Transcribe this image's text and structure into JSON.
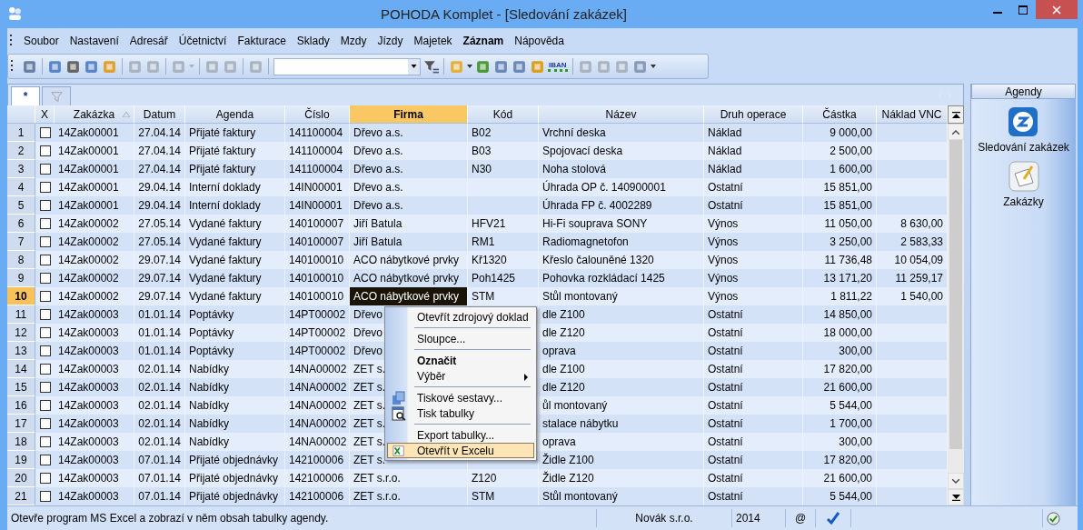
{
  "window": {
    "title": "POHODA Komplet - [Sledování zakázek]"
  },
  "menu": [
    {
      "label": "Soubor",
      "bold": false
    },
    {
      "label": "Nastavení",
      "bold": false
    },
    {
      "label": "Adresář",
      "bold": false
    },
    {
      "label": "Účetnictví",
      "bold": false
    },
    {
      "label": "Fakturace",
      "bold": false
    },
    {
      "label": "Sklady",
      "bold": false
    },
    {
      "label": "Mzdy",
      "bold": false
    },
    {
      "label": "Jízdy",
      "bold": false
    },
    {
      "label": "Majetek",
      "bold": false
    },
    {
      "label": "Záznam",
      "bold": true
    },
    {
      "label": "Nápověda",
      "bold": false
    }
  ],
  "toolbar": {
    "badge": "IBAN"
  },
  "tabs": [
    {
      "kind": "text",
      "label": "*",
      "selected": true
    },
    {
      "kind": "filter",
      "selected": false
    }
  ],
  "columns": [
    {
      "label": "X",
      "selected": false,
      "sorted": false
    },
    {
      "label": "Zakázka",
      "selected": false,
      "sorted": true
    },
    {
      "label": "Datum",
      "selected": false,
      "sorted": false
    },
    {
      "label": "Agenda",
      "selected": false,
      "sorted": false
    },
    {
      "label": "Číslo",
      "selected": false,
      "sorted": false
    },
    {
      "label": "Firma",
      "selected": true,
      "sorted": false
    },
    {
      "label": "Kód",
      "selected": false,
      "sorted": false
    },
    {
      "label": "Název",
      "selected": false,
      "sorted": false
    },
    {
      "label": "Druh operace",
      "selected": false,
      "sorted": false
    },
    {
      "label": "Částka",
      "selected": false,
      "sorted": false
    },
    {
      "label": "Náklad VNC",
      "selected": false,
      "sorted": false
    }
  ],
  "rows": [
    {
      "n": "1",
      "checked": false,
      "selected": false,
      "zakazka": "14Zak00001",
      "datum": "27.04.14",
      "agenda": "Přijaté faktury",
      "cislo": "141100004",
      "firma": "Dřevo a.s.",
      "kod": "B02",
      "nazev": "Vrchní deska",
      "druh": "Náklad",
      "castka": "9 000,00"
    },
    {
      "n": "2",
      "checked": false,
      "selected": false,
      "zakazka": "14Zak00001",
      "datum": "27.04.14",
      "agenda": "Přijaté faktury",
      "cislo": "141100004",
      "firma": "Dřevo a.s.",
      "kod": "B03",
      "nazev": "Spojovací deska",
      "druh": "Náklad",
      "castka": "2 500,00"
    },
    {
      "n": "3",
      "checked": false,
      "selected": false,
      "zakazka": "14Zak00001",
      "datum": "27.04.14",
      "agenda": "Přijaté faktury",
      "cislo": "141100004",
      "firma": "Dřevo a.s.",
      "kod": "N30",
      "nazev": "Noha stolová",
      "druh": "Náklad",
      "castka": "1 600,00"
    },
    {
      "n": "4",
      "checked": false,
      "selected": false,
      "zakazka": "14Zak00001",
      "datum": "29.04.14",
      "agenda": "Interní doklady",
      "cislo": "14IN00001",
      "firma": "Dřevo a.s.",
      "nazev": "Úhrada OP č. 140900001",
      "druh": "Ostatní",
      "castka": "15 851,00"
    },
    {
      "n": "5",
      "checked": false,
      "selected": false,
      "zakazka": "14Zak00001",
      "datum": "29.04.14",
      "agenda": "Interní doklady",
      "cislo": "14IN00001",
      "firma": "Dřevo a.s.",
      "nazev": "Úhrada FP č. 4002289",
      "druh": "Ostatní",
      "castka": "15 851,00"
    },
    {
      "n": "6",
      "checked": false,
      "selected": false,
      "zakazka": "14Zak00002",
      "datum": "27.05.14",
      "agenda": "Vydané faktury",
      "cislo": "140100007",
      "firma": "Jiří Batula",
      "kod": "HFV21",
      "nazev": "Hi-Fi souprava SONY",
      "druh": "Výnos",
      "castka": "11 050,00",
      "naklad": "8 630,00"
    },
    {
      "n": "7",
      "checked": false,
      "selected": false,
      "zakazka": "14Zak00002",
      "datum": "27.05.14",
      "agenda": "Vydané faktury",
      "cislo": "140100007",
      "firma": "Jiří Batula",
      "kod": "RM1",
      "nazev": "Radiomagnetofon",
      "druh": "Výnos",
      "castka": "3 250,00",
      "naklad": "2 583,33"
    },
    {
      "n": "8",
      "checked": false,
      "selected": false,
      "zakazka": "14Zak00002",
      "datum": "29.07.14",
      "agenda": "Vydané faktury",
      "cislo": "140100010",
      "firma": "ACO nábytkové prvky",
      "kod": "Kř1320",
      "nazev": "Křeslo čalouněné 1320",
      "druh": "Výnos",
      "castka": "11 736,48",
      "naklad": "10 054,09"
    },
    {
      "n": "9",
      "checked": false,
      "selected": false,
      "zakazka": "14Zak00002",
      "datum": "29.07.14",
      "agenda": "Vydané faktury",
      "cislo": "140100010",
      "firma": "ACO nábytkové prvky",
      "kod": "Poh1425",
      "nazev": "Pohovka rozkládací 1425",
      "druh": "Výnos",
      "castka": "13 171,20",
      "naklad": "11 259,17"
    },
    {
      "n": "10",
      "checked": false,
      "selected": true,
      "zakazka": "14Zak00002",
      "datum": "29.07.14",
      "agenda": "Vydané faktury",
      "cislo": "140100010",
      "firma": "ACO nábytkové prvky",
      "kod": "STM",
      "nazev": "Stůl montovaný",
      "druh": "Výnos",
      "castka": "1 811,22",
      "naklad": "1 540,00"
    },
    {
      "n": "11",
      "checked": false,
      "selected": false,
      "zakazka": "14Zak00003",
      "datum": "01.01.14",
      "agenda": "Poptávky",
      "cislo": "14PT00002",
      "firma": "Dřevo",
      "nazev": "dle Z100",
      "druh": "Ostatní",
      "castka": "14 850,00"
    },
    {
      "n": "12",
      "checked": false,
      "selected": false,
      "zakazka": "14Zak00003",
      "datum": "01.01.14",
      "agenda": "Poptávky",
      "cislo": "14PT00002",
      "firma": "Dřevo",
      "nazev": "dle Z120",
      "druh": "Ostatní",
      "castka": "18 000,00"
    },
    {
      "n": "13",
      "checked": false,
      "selected": false,
      "zakazka": "14Zak00003",
      "datum": "01.01.14",
      "agenda": "Poptávky",
      "cislo": "14PT00002",
      "firma": "Dřevo",
      "nazev": "oprava",
      "druh": "Ostatní",
      "castka": "300,00"
    },
    {
      "n": "14",
      "checked": false,
      "selected": false,
      "zakazka": "14Zak00003",
      "datum": "02.01.14",
      "agenda": "Nabídky",
      "cislo": "14NA00002",
      "firma": "ZET s.",
      "nazev": "dle Z100",
      "druh": "Ostatní",
      "castka": "17 820,00"
    },
    {
      "n": "15",
      "checked": false,
      "selected": false,
      "zakazka": "14Zak00003",
      "datum": "02.01.14",
      "agenda": "Nabídky",
      "cislo": "14NA00002",
      "firma": "ZET s.",
      "nazev": "dle Z120",
      "druh": "Ostatní",
      "castka": "21 600,00"
    },
    {
      "n": "16",
      "checked": false,
      "selected": false,
      "zakazka": "14Zak00003",
      "datum": "02.01.14",
      "agenda": "Nabídky",
      "cislo": "14NA00002",
      "firma": "ZET s.",
      "nazev": "ůl montovaný",
      "druh": "Ostatní",
      "castka": "5 544,00"
    },
    {
      "n": "17",
      "checked": false,
      "selected": false,
      "zakazka": "14Zak00003",
      "datum": "02.01.14",
      "agenda": "Nabídky",
      "cislo": "14NA00002",
      "firma": "ZET s.",
      "nazev": "stalace nábytku",
      "druh": "Ostatní",
      "castka": "1 700,00"
    },
    {
      "n": "18",
      "checked": false,
      "selected": false,
      "zakazka": "14Zak00003",
      "datum": "02.01.14",
      "agenda": "Nabídky",
      "cislo": "14NA00002",
      "firma": "ZET s.",
      "nazev": "oprava",
      "druh": "Ostatní",
      "castka": "300,00"
    },
    {
      "n": "19",
      "checked": false,
      "selected": false,
      "zakazka": "14Zak00003",
      "datum": "07.01.14",
      "agenda": "Přijaté objednávky",
      "cislo": "142100006",
      "firma": "ZET s.",
      "nazev": "Židle Z100",
      "druh": "Ostatní",
      "castka": "17 820,00"
    },
    {
      "n": "20",
      "checked": false,
      "selected": false,
      "zakazka": "14Zak00003",
      "datum": "07.01.14",
      "agenda": "Přijaté objednávky",
      "cislo": "142100006",
      "firma": "ZET s.r.o.",
      "kod": "Z120",
      "nazev": "Židle Z120",
      "druh": "Ostatní",
      "castka": "21 600,00"
    },
    {
      "n": "21",
      "checked": false,
      "selected": false,
      "zakazka": "14Zak00003",
      "datum": "07.01.14",
      "agenda": "Přijaté objednávky",
      "cislo": "142100006",
      "firma": "ZET s.r.o.",
      "kod": "STM",
      "nazev": "Stůl montovaný",
      "druh": "Ostatní",
      "castka": "5 544,00"
    }
  ],
  "context_menu": [
    {
      "kind": "item",
      "label": "Otevřít zdrojový doklad",
      "bold": false,
      "submenu": false,
      "selected": false
    },
    {
      "kind": "separator"
    },
    {
      "kind": "item",
      "label": "Sloupce...",
      "bold": false,
      "submenu": false,
      "selected": false
    },
    {
      "kind": "separator"
    },
    {
      "kind": "item",
      "label": "Označit",
      "bold": true,
      "submenu": false,
      "selected": false
    },
    {
      "kind": "item",
      "label": "Výběr",
      "bold": false,
      "submenu": true,
      "selected": false
    },
    {
      "kind": "separator"
    },
    {
      "kind": "item",
      "label": "Tiskové sestavy...",
      "bold": false,
      "submenu": false,
      "selected": false
    },
    {
      "kind": "item",
      "label": "Tisk tabulky",
      "bold": false,
      "submenu": false,
      "selected": false
    },
    {
      "kind": "separator"
    },
    {
      "kind": "item",
      "label": "Export tabulky...",
      "bold": false,
      "submenu": false,
      "selected": false
    },
    {
      "kind": "item",
      "label": "Otevřít v Excelu",
      "bold": false,
      "submenu": false,
      "selected": true
    }
  ],
  "sidebar": {
    "title": "Agendy",
    "items": [
      {
        "kind": "tracking",
        "label": "Sledování zakázek"
      },
      {
        "kind": "orders",
        "label": "Zakázky"
      }
    ]
  },
  "status_bar": {
    "message": "Otevře program MS Excel a zobrazí v něm obsah tabulky agendy.",
    "company": "Novák s.r.o.",
    "year": "2014",
    "mail": "@"
  }
}
